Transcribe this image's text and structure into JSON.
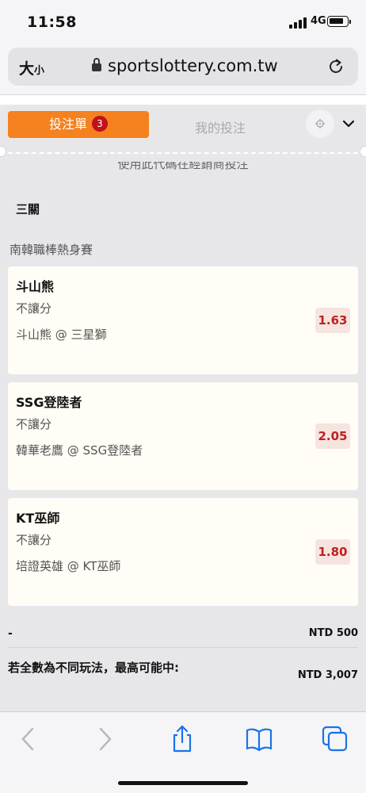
{
  "status": {
    "time": "11:58",
    "network": "4G"
  },
  "browser": {
    "text_size": "大",
    "text_size_small": "小",
    "domain": "sportslottery.com.tw"
  },
  "betslip": {
    "tab_active": "投注單",
    "tab_count": "3",
    "tab_other": "我的投注",
    "cut_text": "使用此代碼在經銷商投注",
    "mode": "三關",
    "league": "南韓職棒熱身賽",
    "selections": [
      {
        "team": "斗山熊",
        "market": "不讓分",
        "match": "斗山熊 @ 三星獅",
        "odds": "1.63"
      },
      {
        "team": "SSG登陸者",
        "market": "不讓分",
        "match": "韓華老鷹 @ SSG登陸者",
        "odds": "2.05"
      },
      {
        "team": "KT巫師",
        "market": "不讓分",
        "match": "培證英雄 @ KT巫師",
        "odds": "1.80"
      }
    ],
    "stake_label": "-",
    "stake_value": "NTD 500",
    "max_win_label": "若全數為不同玩法，最高可能中:",
    "max_win_value": "NTD 3,007"
  },
  "toolbar_icons": [
    "back-icon",
    "forward-icon",
    "share-icon",
    "bookmarks-icon",
    "tabs-icon"
  ],
  "colors": {
    "accent": "#f5821f",
    "badge": "#c0121b",
    "odds_text": "#bb2222",
    "link_blue": "#1a73e8"
  }
}
